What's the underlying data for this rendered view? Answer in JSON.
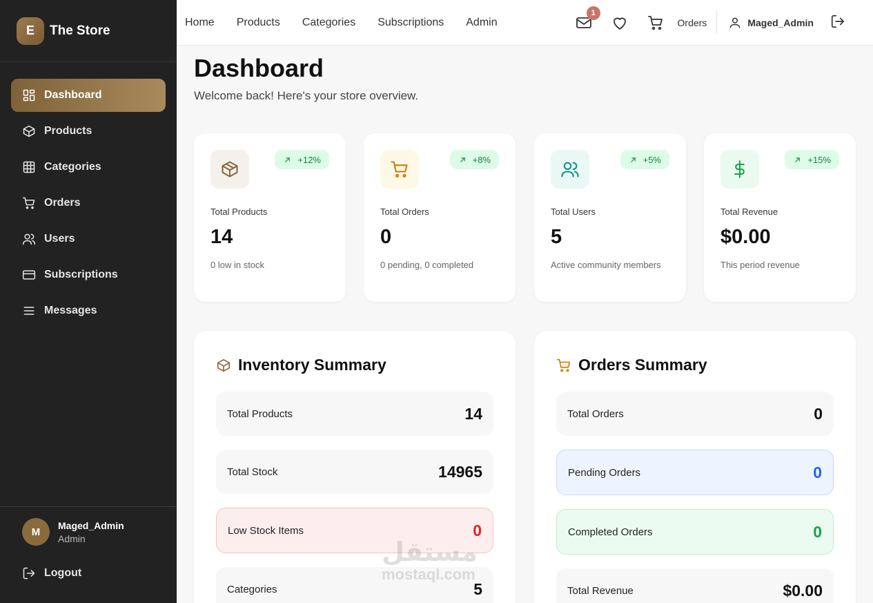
{
  "brand": {
    "initial": "E",
    "name": "The Store"
  },
  "sidebar": {
    "items": [
      {
        "label": "Dashboard",
        "icon": "dashboard-icon",
        "active": true
      },
      {
        "label": "Products",
        "icon": "box-icon"
      },
      {
        "label": "Categories",
        "icon": "grid-icon"
      },
      {
        "label": "Orders",
        "icon": "cart-icon"
      },
      {
        "label": "Users",
        "icon": "users-icon"
      },
      {
        "label": "Subscriptions",
        "icon": "card-icon"
      },
      {
        "label": "Messages",
        "icon": "menu-icon"
      }
    ]
  },
  "user": {
    "initial": "M",
    "name": "Maged_Admin",
    "role": "Admin",
    "logout": "Logout"
  },
  "topbar": {
    "nav": [
      "Home",
      "Products",
      "Categories",
      "Subscriptions",
      "Admin"
    ],
    "mail_badge": "1",
    "orders": "Orders",
    "username": "Maged_Admin"
  },
  "page": {
    "title": "Dashboard",
    "subtitle": "Welcome back! Here's your store overview."
  },
  "stats": [
    {
      "label": "Total Products",
      "value": "14",
      "note": "0 low in stock",
      "trend": "+12%",
      "icon": "box-icon",
      "icon_color": "#8a6a3d",
      "icon_bg": "#f4f1ec"
    },
    {
      "label": "Total Orders",
      "value": "0",
      "note": "0 pending, 0 completed",
      "trend": "+8%",
      "icon": "cart-icon",
      "icon_color": "#d97706",
      "icon_bg": "#fef9e7"
    },
    {
      "label": "Total Users",
      "value": "5",
      "note": "Active community members",
      "trend": "+5%",
      "icon": "users-icon",
      "icon_color": "#0d9488",
      "icon_bg": "#e9f8f5"
    },
    {
      "label": "Total Revenue",
      "value": "$0.00",
      "note": "This period revenue",
      "trend": "+15%",
      "icon": "dollar-icon",
      "icon_color": "#16a34a",
      "icon_bg": "#eafaf0"
    }
  ],
  "inventory": {
    "title": "Inventory Summary",
    "rows": [
      {
        "label": "Total Products",
        "value": "14"
      },
      {
        "label": "Total Stock",
        "value": "14965"
      },
      {
        "label": "Low Stock Items",
        "value": "0"
      },
      {
        "label": "Categories",
        "value": "5"
      }
    ]
  },
  "orders_summary": {
    "title": "Orders Summary",
    "rows": [
      {
        "label": "Total Orders",
        "value": "0"
      },
      {
        "label": "Pending Orders",
        "value": "0"
      },
      {
        "label": "Completed Orders",
        "value": "0"
      },
      {
        "label": "Total Revenue",
        "value": "$0.00"
      }
    ]
  },
  "watermark": {
    "arabic": "مستقل",
    "latin": "mostaql.com"
  }
}
